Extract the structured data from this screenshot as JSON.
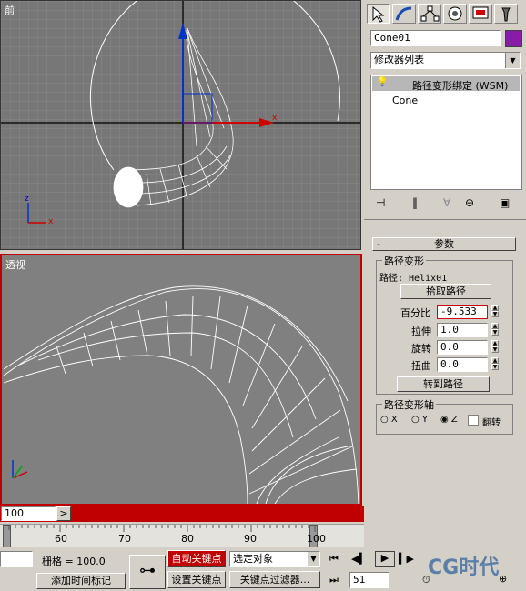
{
  "viewports": {
    "front": {
      "label": "前",
      "axis_x": "x",
      "axis_z": "z"
    },
    "perspective": {
      "label": "透视"
    }
  },
  "command_panel": {
    "tabs": [
      "create-icon",
      "modify-icon",
      "hierarchy-icon",
      "motion-icon",
      "display-icon",
      "utilities-icon"
    ],
    "object_name": "Cone01",
    "object_color": "#8a1aa8",
    "modifier_list": "修改器列表",
    "stack": {
      "top": "路径变形绑定 (WSM)",
      "base": "Cone"
    },
    "rollout_minus": "-",
    "rollout_title": "参数",
    "group_path_deform": "路径变形",
    "path_label": "路径: Helix01",
    "pick_path_button": "拾取路径",
    "percent": {
      "label": "百分比",
      "value": "-9.533"
    },
    "stretch": {
      "label": "拉伸",
      "value": "1.0"
    },
    "rotation": {
      "label": "旋转",
      "value": "0.0"
    },
    "twist": {
      "label": "扭曲",
      "value": "0.0"
    },
    "move_to_path_button": "转到路径",
    "group_axis": "路径变形轴",
    "axis_options": [
      "X",
      "Y",
      "Z"
    ],
    "axis_selected": "Z",
    "flip_label": "翻转"
  },
  "timeline": {
    "frame_field": "100",
    "frame_arrow": ">",
    "ruler_labels": [
      "60",
      "70",
      "80",
      "90",
      "100"
    ]
  },
  "status": {
    "grid_label": "栅格 = 100.0",
    "add_time_tag": "添加时间标记",
    "auto_key": "自动关键点",
    "set_key": "设置关键点",
    "selected_object": "选定对象",
    "key_filters": "关键点过滤器...",
    "current_frame": "51",
    "watermark": "CG时代"
  }
}
